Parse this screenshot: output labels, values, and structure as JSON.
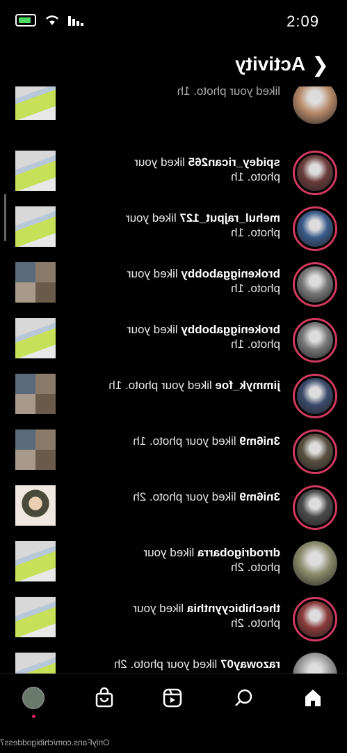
{
  "status_bar": {
    "time": "2:09"
  },
  "header": {
    "title": "Activity"
  },
  "rows": [
    {
      "text": "liked your photo. 1h",
      "username": "",
      "partial": true,
      "ring": false,
      "avatar_color": "#b88a6a",
      "thumb": "green"
    },
    {
      "username": "spidey_rican265",
      "action": " liked your",
      "line2": "photo. 1h",
      "ring": true,
      "avatar_color": "#6b3b3b",
      "thumb": "green"
    },
    {
      "username": "mehul_rajput_127",
      "action": " liked your",
      "line2": "photo. 1h",
      "ring": true,
      "avatar_color": "#3a5a8a",
      "thumb": "green"
    },
    {
      "username": "brokeniggabobby",
      "action": " liked your",
      "line2": "photo. 1h",
      "ring": true,
      "avatar_color": "#777777",
      "thumb": "collage"
    },
    {
      "username": "brokeniggabobby",
      "action": " liked your",
      "line2": "photo. 1h",
      "ring": true,
      "avatar_color": "#777777",
      "thumb": "green"
    },
    {
      "username": "jimmyk_foe",
      "action": " liked your photo. 1h",
      "line2": "",
      "ring": true,
      "avatar_color": "#3b4a6b",
      "thumb": "collage"
    },
    {
      "username": "3ni6m9",
      "action": " liked your photo. 1h",
      "line2": "",
      "ring": true,
      "avatar_color": "#5a5040",
      "thumb": "collage"
    },
    {
      "username": "3ni6m9",
      "action": " liked your photo. 2h",
      "line2": "",
      "ring": true,
      "avatar_color": "#4a4a4a",
      "thumb": "face"
    },
    {
      "username": "drrodrigobarra",
      "action": " liked your",
      "line2": "photo. 2h",
      "ring": false,
      "avatar_color": "#8a8a6a",
      "thumb": "green"
    },
    {
      "username": "thechibicyynthia",
      "action": " liked your",
      "line2": "photo. 2h",
      "ring": true,
      "avatar_color": "#8a3a3a",
      "thumb": "green"
    },
    {
      "username": "razoway07",
      "action": " liked your photo. 2h",
      "line2": "",
      "ring": false,
      "avatar_color": "#9a9a9a",
      "thumb": "green"
    }
  ],
  "nav": {
    "items": [
      "profile",
      "shop",
      "reels",
      "search",
      "home"
    ]
  },
  "watermark": "OnlyFans.com/chibigoddess7"
}
